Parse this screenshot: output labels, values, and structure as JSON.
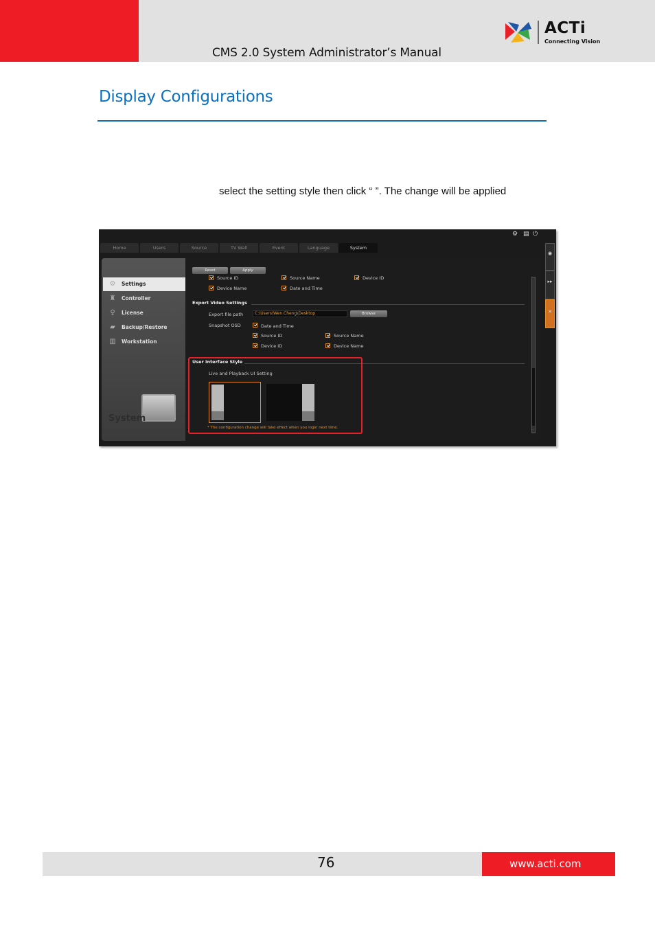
{
  "header": {
    "manual_title": "CMS 2.0 System Administrator’s Manual",
    "logo_word": "ACTi",
    "logo_tagline": "Connecting Vision",
    "logo_colors": [
      "#e8202a",
      "#1f56a8",
      "#f3b41b",
      "#3aa64a"
    ]
  },
  "section": {
    "title": "Display Configurations",
    "arrow1": "",
    "arrow2": "",
    "body_line": "select the setting style then click “         ”. The change will be applied"
  },
  "screenshot": {
    "toolbar_icons": [
      "gear-icon",
      "document-icon",
      "power-icon"
    ],
    "tabs": [
      "Home",
      "Users",
      "Source",
      "TV Wall",
      "Event",
      "Language",
      "System"
    ],
    "active_tab": "System",
    "nav_items": [
      "Settings",
      "Controller",
      "License",
      "Backup/Restore",
      "Workstation"
    ],
    "active_nav": "Settings",
    "system_label": "System",
    "buttons": {
      "reset": "Reset",
      "apply": "Apply",
      "browse": "Browse"
    },
    "top_checks": [
      "Source ID",
      "Source Name",
      "Device ID",
      "Device Name",
      "Date and Time"
    ],
    "export_section": "Export Video Settings",
    "export_path_label": "Export file path",
    "export_path_value": "C:\\Users\\Wen.Cheng\\Desktop",
    "snapshot_label": "Snapshot OSD",
    "snapshot_checks": [
      "Date and Time",
      "Source ID",
      "Source Name",
      "Device ID",
      "Device Name"
    ],
    "ui_style_section": "User Interface Style",
    "ui_setting_label": "Live and Playback UI Setting",
    "note": "* The configuration change will take effect when you login next time."
  },
  "footer": {
    "page_number": "76",
    "url": "www.acti.com"
  }
}
